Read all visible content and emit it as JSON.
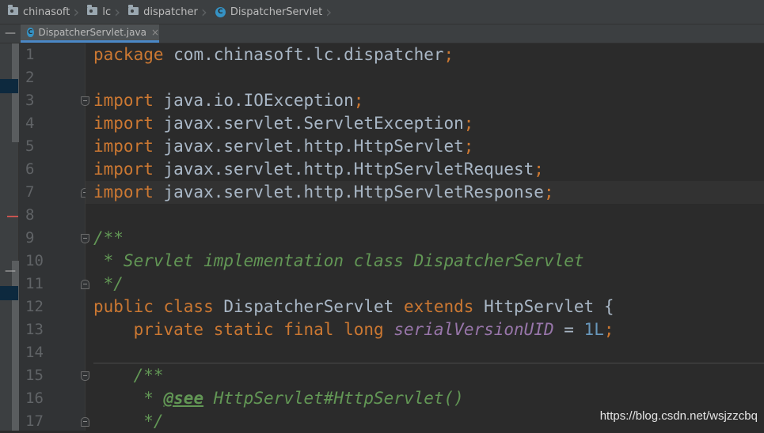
{
  "breadcrumb": {
    "items": [
      {
        "label": "chinasoft",
        "icon": "folder-icon"
      },
      {
        "label": "lc",
        "icon": "folder-icon"
      },
      {
        "label": "dispatcher",
        "icon": "folder-icon"
      },
      {
        "label": "DispatcherServlet",
        "icon": "class-icon"
      }
    ]
  },
  "tabs": {
    "active_label": "DispatcherServlet.java",
    "class_icon_letter": "C",
    "close_glyph": "×"
  },
  "gutter": {
    "line_numbers": [
      "1",
      "2",
      "3",
      "4",
      "5",
      "6",
      "7",
      "8",
      "9",
      "10",
      "11",
      "12",
      "13",
      "14",
      "15",
      "16",
      "17"
    ]
  },
  "code": {
    "lines": [
      [
        {
          "t": "package",
          "c": "kw"
        },
        {
          "t": " com.chinasoft.lc.dispatcher"
        },
        {
          "t": ";",
          "c": "kw"
        }
      ],
      [],
      [
        {
          "t": "import",
          "c": "kw"
        },
        {
          "t": " java.io.IOException"
        },
        {
          "t": ";",
          "c": "kw"
        }
      ],
      [
        {
          "t": "import",
          "c": "kw"
        },
        {
          "t": " javax.servlet.ServletException"
        },
        {
          "t": ";",
          "c": "kw"
        }
      ],
      [
        {
          "t": "import",
          "c": "kw"
        },
        {
          "t": " javax.servlet.http.HttpServlet"
        },
        {
          "t": ";",
          "c": "kw"
        }
      ],
      [
        {
          "t": "import",
          "c": "kw"
        },
        {
          "t": " javax.servlet.http.HttpServletRequest"
        },
        {
          "t": ";",
          "c": "kw"
        }
      ],
      [
        {
          "t": "import",
          "c": "kw"
        },
        {
          "t": " javax.servlet.http.HttpServletResponse"
        },
        {
          "t": ";",
          "c": "kw"
        }
      ],
      [],
      [
        {
          "t": "/**",
          "c": "cm"
        }
      ],
      [
        {
          "t": " * Servlet implementation class DispatcherServlet",
          "c": "cm"
        }
      ],
      [
        {
          "t": " */",
          "c": "cm"
        }
      ],
      [
        {
          "t": "public class",
          "c": "kw"
        },
        {
          "t": " DispatcherServlet "
        },
        {
          "t": "extends",
          "c": "kw"
        },
        {
          "t": " HttpServlet {"
        }
      ],
      [
        {
          "t": "    private static final long",
          "c": "kw"
        },
        {
          "t": " "
        },
        {
          "t": "serialVersionUID",
          "c": "fld"
        },
        {
          "t": " = "
        },
        {
          "t": "1L",
          "c": "num"
        },
        {
          "t": ";",
          "c": "kw"
        }
      ],
      [],
      [
        {
          "t": "    /**",
          "c": "cm"
        }
      ],
      [
        {
          "t": "     * ",
          "c": "cm"
        },
        {
          "t": "@see",
          "c": "tag"
        },
        {
          "t": " HttpServlet#HttpServlet()",
          "c": "cm"
        }
      ],
      [
        {
          "t": "     */",
          "c": "cm"
        }
      ]
    ]
  },
  "watermark": "https://blog.csdn.net/wsjzzcbq",
  "colors": {
    "keyword": "#cc7832",
    "comment": "#629755",
    "field": "#9876aa",
    "number": "#6897bb",
    "text": "#a9b7c6",
    "background": "#2b2b2b"
  }
}
